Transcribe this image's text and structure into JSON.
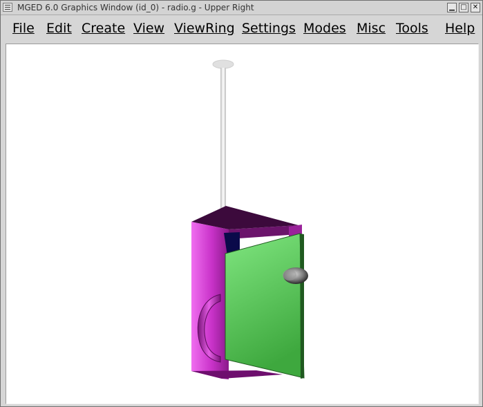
{
  "window": {
    "title": "MGED 6.0 Graphics Window (id_0) - radio.g - Upper Right",
    "minimize_icon": "minimize-icon",
    "maximize_icon": "maximize-icon",
    "close_icon": "close-icon"
  },
  "menubar": {
    "items": [
      {
        "label": "File"
      },
      {
        "label": "Edit"
      },
      {
        "label": "Create"
      },
      {
        "label": "View"
      },
      {
        "label": "ViewRing"
      },
      {
        "label": "Settings"
      },
      {
        "label": "Modes"
      },
      {
        "label": "Misc"
      },
      {
        "label": "Tools"
      },
      {
        "label": "Help"
      }
    ]
  },
  "scene": {
    "model": "radio",
    "background": "#ffffff",
    "colors": {
      "body_magenta": "#c832c8",
      "body_highlight": "#f06ef0",
      "top_purple": "#3c0a3c",
      "door_green": "#6ad86a",
      "door_dark": "#2f8f2f",
      "antenna": "#e8e8e8",
      "knob_gray": "#7a7a7a",
      "inner_navy": "#0a0a4a"
    }
  }
}
